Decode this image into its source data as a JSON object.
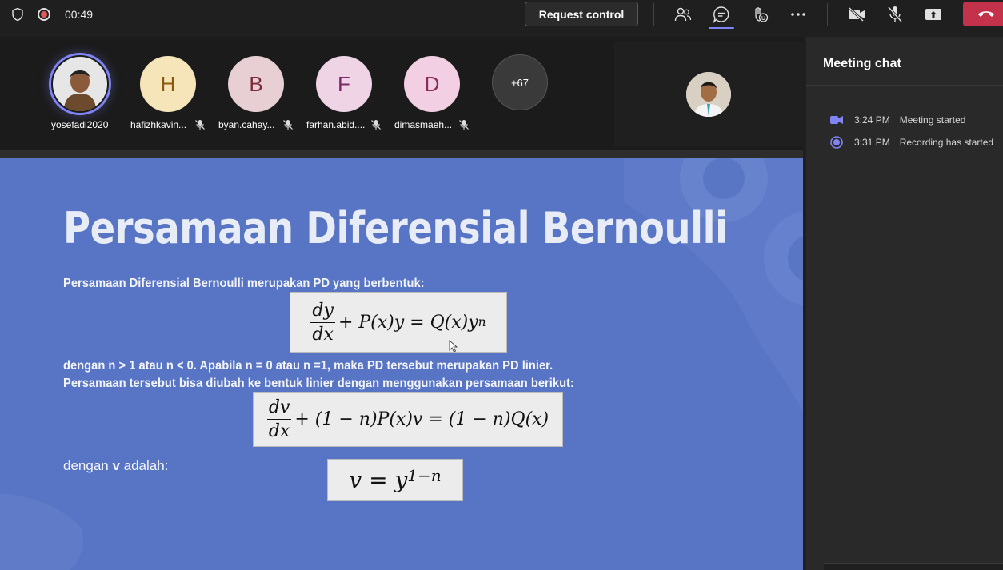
{
  "topbar": {
    "timer": "00:49",
    "request_control_label": "Request control",
    "icons": [
      "shield-icon",
      "record-icon",
      "people-icon",
      "chat-icon",
      "react-icon",
      "more-icon",
      "camera-off-icon",
      "mic-off-icon",
      "share-icon",
      "leave-icon"
    ],
    "accent": "#7f85f5",
    "leave_color": "#c4314b"
  },
  "participants": [
    {
      "name": "yosefadi2020",
      "initial": "",
      "bg": "#d9d9d9",
      "color": "#333333",
      "photo": true
    },
    {
      "name": "hafizhkavin...",
      "initial": "H",
      "bg": "#f5e5b8",
      "color": "#8a5a12",
      "muted": true
    },
    {
      "name": "byan.cahay...",
      "initial": "B",
      "bg": "#e8cfd3",
      "color": "#7a2a3a",
      "muted": true
    },
    {
      "name": "farhan.abid....",
      "initial": "F",
      "bg": "#efd4e6",
      "color": "#7a2a6a",
      "muted": true
    },
    {
      "name": "dimasmaeh...",
      "initial": "D",
      "bg": "#f2cfe3",
      "color": "#8a2a5a",
      "muted": true
    }
  ],
  "more_participants": "+67",
  "slide": {
    "title": "Persamaan Diferensial Bernoulli",
    "line1": "Persamaan Diferensial Bernoulli merupakan PD yang berbentuk:",
    "line2": "dengan n > 1 atau n < 0. Apabila n = 0 atau n =1, maka PD tersebut merupakan PD linier.",
    "line3": "Persamaan tersebut bisa diubah ke bentuk linier dengan menggunakan persamaan berikut:",
    "line4_prefix": "dengan ",
    "line4_bold": "v",
    "line4_suffix": " adalah:",
    "eq1": {
      "num": "dy",
      "den": "dx",
      "rest": "+ P(x)y = Q(x)y",
      "sup": "n"
    },
    "eq2": {
      "num": "dv",
      "den": "dx",
      "rest": "+ (1 − n)P(x)v = (1 − n)Q(x)"
    },
    "eq3": {
      "base": "v = y",
      "sup": "1−n"
    },
    "bg_color": "#5874c4"
  },
  "chat": {
    "title": "Meeting chat",
    "events": [
      {
        "time": "3:24 PM",
        "text": "Meeting started",
        "icon": "video-icon"
      },
      {
        "time": "3:31 PM",
        "text": "Recording has started",
        "icon": "recording-icon"
      }
    ]
  }
}
